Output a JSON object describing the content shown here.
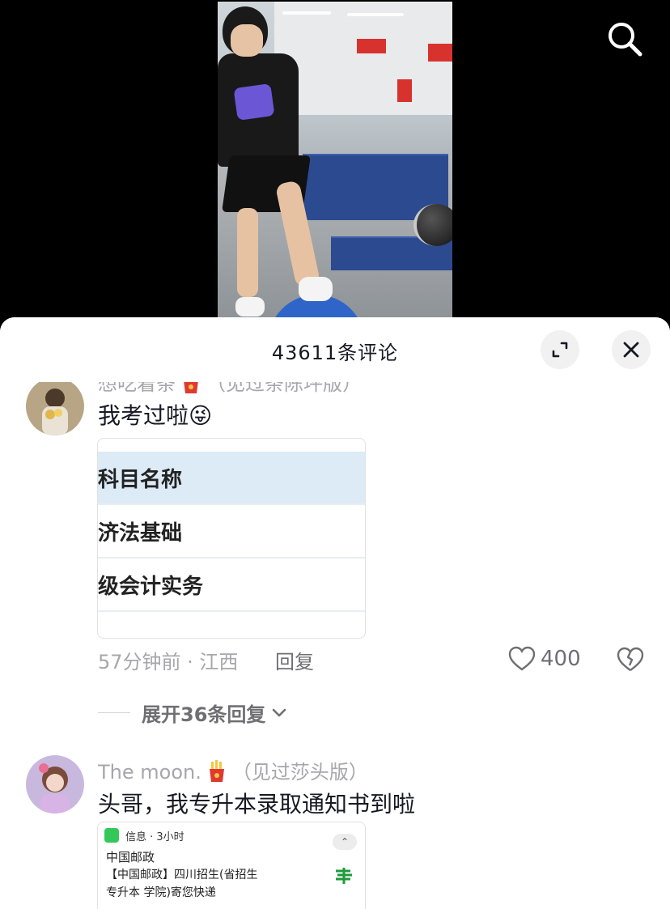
{
  "top_bar": {
    "search_icon": "search-icon"
  },
  "sheet": {
    "title": "43611条评论",
    "expand_icon": "expand-icon",
    "close_icon": "close-icon"
  },
  "comments": [
    {
      "username": "想吃着条",
      "username_suffix": "（见过条陈坪版）",
      "text": "我考过啦😜",
      "table": {
        "header": "科目名称",
        "rows": [
          "济法基础",
          "级会计实务"
        ]
      },
      "time_location": "57分钟前 · 江西",
      "reply_label": "回复",
      "likes": "400",
      "expand_replies": "展开36条回复"
    },
    {
      "username": "The moon.",
      "username_suffix": "（见过莎头版）",
      "text": "头哥，我专升本录取通知书到啦",
      "sms": {
        "app": "信息 · 3小时",
        "sender": "中国邮政",
        "line1": "【中国邮政】四川招生(省招生",
        "line2": "专升本 学院)寄您快递"
      }
    }
  ],
  "colors": {
    "text_primary": "#161823",
    "text_secondary": "#a7a7ab",
    "sheet_bg": "#ffffff",
    "video_bg": "#000000"
  }
}
